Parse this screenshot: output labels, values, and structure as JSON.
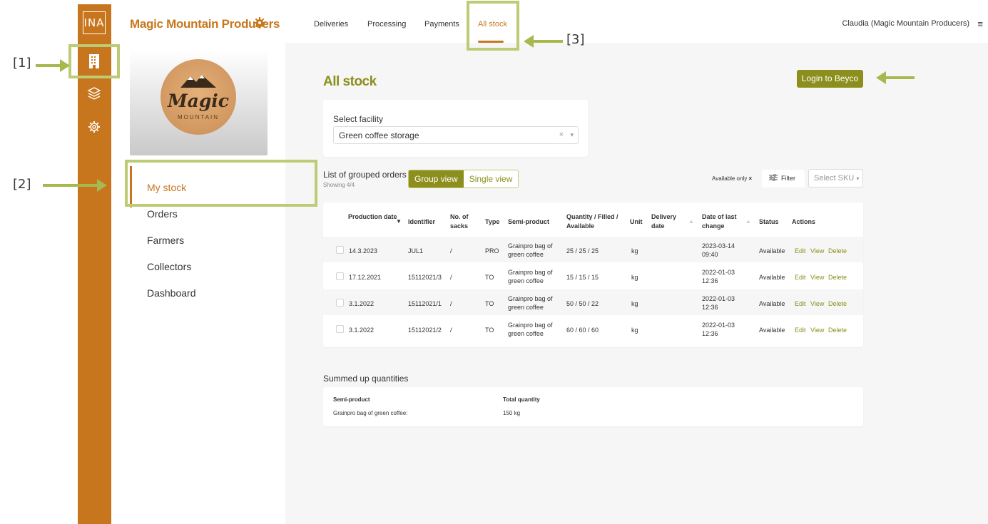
{
  "annotations": {
    "label1": "[1]",
    "label2": "[2]",
    "label3": "[3]"
  },
  "rail": {
    "logo": "INA"
  },
  "sidebar": {
    "company": "Magic Mountain Producers",
    "logo": {
      "word1": "Magic",
      "word2": "MOUNTAIN"
    },
    "items": [
      {
        "label": "My stock"
      },
      {
        "label": "Orders"
      },
      {
        "label": "Farmers"
      },
      {
        "label": "Collectors"
      },
      {
        "label": "Dashboard"
      }
    ]
  },
  "topbar": {
    "tabs": [
      {
        "label": "Deliveries"
      },
      {
        "label": "Processing"
      },
      {
        "label": "Payments"
      },
      {
        "label": "All stock"
      }
    ],
    "user": "Claudia (Magic Mountain Producers)"
  },
  "page": {
    "title": "All stock",
    "login_button": "Login to Beyco",
    "facility_label": "Select facility",
    "facility_value": "Green coffee storage",
    "list_title": "List of grouped orders",
    "showing": "Showing 4/4",
    "group_view": "Group view",
    "single_view": "Single view",
    "available_only": "Available only",
    "filter": "Filter",
    "select_sku": "Select SKU"
  },
  "table": {
    "headers": {
      "production_date": "Production date",
      "identifier": "Identifier",
      "sacks": "No. of sacks",
      "type": "Type",
      "semi_product": "Semi-product",
      "quantity": "Quantity / Filled / Available",
      "unit": "Unit",
      "delivery_date": "Delivery date",
      "last_change": "Date of last change",
      "status": "Status",
      "actions": "Actions"
    },
    "rows": [
      {
        "date": "14.3.2023",
        "identifier": "JUL1",
        "sacks": "/",
        "type": "PRO",
        "semi": "Grainpro bag of green coffee",
        "qty": "25 / 25 / 25",
        "unit": "kg",
        "last_change": "2023-03-14 09:40",
        "status": "Available"
      },
      {
        "date": "17.12.2021",
        "identifier": "15112021/3",
        "sacks": "/",
        "type": "TO",
        "semi": "Grainpro bag of green coffee",
        "qty": "15 / 15 / 15",
        "unit": "kg",
        "last_change": "2022-01-03 12:36",
        "status": "Available"
      },
      {
        "date": "3.1.2022",
        "identifier": "15112021/1",
        "sacks": "/",
        "type": "TO",
        "semi": "Grainpro bag of green coffee",
        "qty": "50 / 50 / 22",
        "unit": "kg",
        "last_change": "2022-01-03 12:36",
        "status": "Available"
      },
      {
        "date": "3.1.2022",
        "identifier": "15112021/2",
        "sacks": "/",
        "type": "TO",
        "semi": "Grainpro bag of green coffee",
        "qty": "60 / 60 / 60",
        "unit": "kg",
        "last_change": "2022-01-03 12:36",
        "status": "Available"
      }
    ],
    "actions": {
      "edit": "Edit",
      "view": "View",
      "delete": "Delete"
    }
  },
  "summary": {
    "title": "Summed up quantities",
    "col_semi": "Semi-product",
    "col_total": "Total quantity",
    "rows": [
      {
        "semi": "Grainpro bag of green coffee:",
        "total": "150 kg"
      }
    ]
  },
  "colors": {
    "brand_orange": "#c8761d",
    "olive": "#8c8f1d",
    "annotation_green": "#a6b94e"
  }
}
